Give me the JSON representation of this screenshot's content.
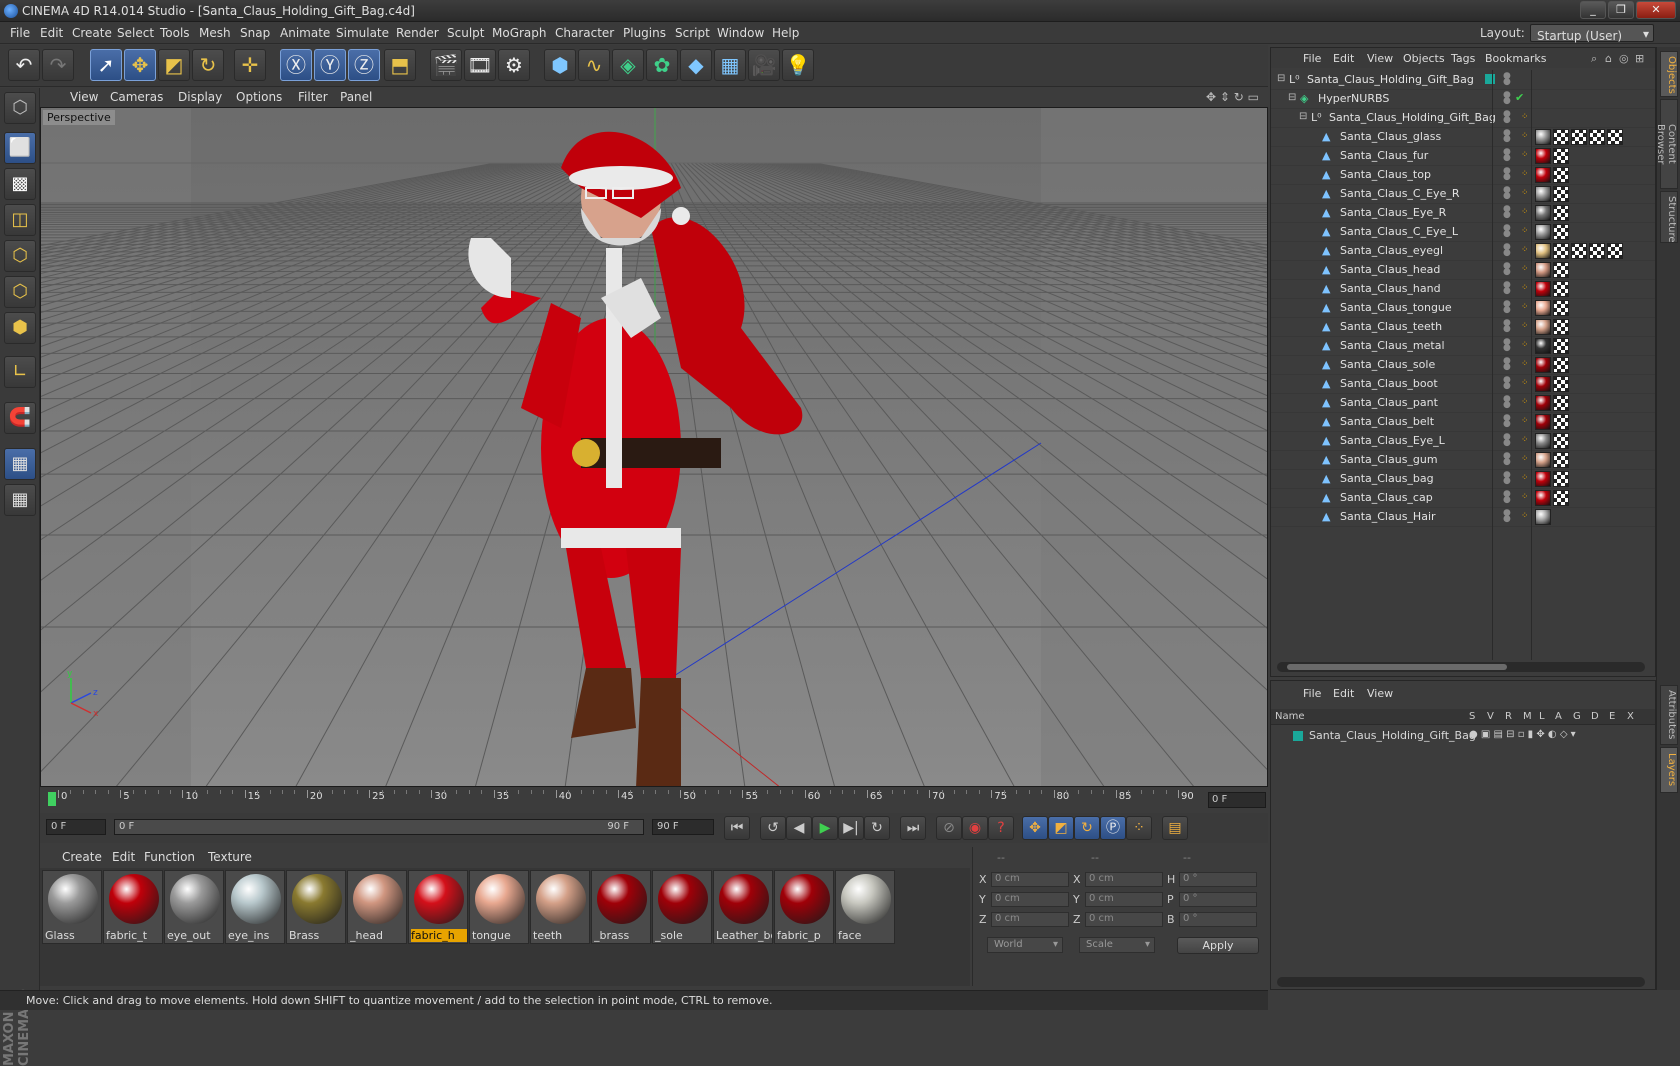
{
  "window": {
    "title": "CINEMA 4D R14.014 Studio - [Santa_Claus_Holding_Gift_Bag.c4d]",
    "controls": [
      "_",
      "❐",
      "✕"
    ]
  },
  "menu": [
    "File",
    "Edit",
    "Create",
    "Select",
    "Tools",
    "Mesh",
    "Snap",
    "Animate",
    "Simulate",
    "Render",
    "Sculpt",
    "MoGraph",
    "Character",
    "Plugins",
    "Script",
    "Window",
    "Help"
  ],
  "layout": {
    "label": "Layout:",
    "value": "Startup (User)"
  },
  "viewport": {
    "menu": [
      "View",
      "Cameras",
      "Display",
      "Options",
      "Filter",
      "Panel"
    ],
    "label": "Perspective"
  },
  "timeline": {
    "ticks": [
      "0",
      "5",
      "10",
      "15",
      "20",
      "25",
      "30",
      "35",
      "40",
      "45",
      "50",
      "55",
      "60",
      "65",
      "70",
      "75",
      "80",
      "85",
      "90"
    ],
    "current_frame": "0 F",
    "start_field": "0 F",
    "range_start": "0 F",
    "range_end": "90 F",
    "end_field": "90 F"
  },
  "materials": {
    "menu": [
      "Create",
      "Edit",
      "Function",
      "Texture"
    ],
    "items": [
      {
        "label": "Glass",
        "color": "#9a9a9a",
        "selected": false
      },
      {
        "label": "fabric_t",
        "color": "#c0000a",
        "selected": false
      },
      {
        "label": "eye_out",
        "color": "#9a9a9a",
        "selected": false
      },
      {
        "label": "eye_ins",
        "color": "#b8c8cc",
        "selected": false
      },
      {
        "label": "Brass",
        "color": "#8a7a30",
        "selected": false
      },
      {
        "label": "_head",
        "color": "#d09680",
        "selected": false
      },
      {
        "label": "fabric_h",
        "color": "#d4101a",
        "selected": true
      },
      {
        "label": "tongue",
        "color": "#e8a890",
        "selected": false
      },
      {
        "label": "teeth",
        "color": "#d4a088",
        "selected": false
      },
      {
        "label": "_brass",
        "color": "#a00008",
        "selected": false
      },
      {
        "label": "_sole",
        "color": "#a00008",
        "selected": false
      },
      {
        "label": "Leather_bo",
        "color": "#a00008",
        "selected": false
      },
      {
        "label": "fabric_p",
        "color": "#a00008",
        "selected": false
      },
      {
        "label": "face",
        "color": "#c8c8c0",
        "selected": false
      }
    ]
  },
  "coords": {
    "headers": [
      "--",
      "--",
      "--"
    ],
    "rows": [
      {
        "a": "X",
        "av": "0 cm",
        "b": "X",
        "bv": "0 cm",
        "c": "H",
        "cv": "0 °"
      },
      {
        "a": "Y",
        "av": "0 cm",
        "b": "Y",
        "bv": "0 cm",
        "c": "P",
        "cv": "0 °"
      },
      {
        "a": "Z",
        "av": "0 cm",
        "b": "Z",
        "bv": "0 cm",
        "c": "B",
        "cv": "0 °"
      }
    ],
    "mode": "World",
    "transform": "Scale",
    "apply": "Apply"
  },
  "status": "Move: Click and drag to move elements. Hold down SHIFT to quantize movement / add to the selection in point mode, CTRL to remove.",
  "objects": {
    "menu": [
      "File",
      "Edit",
      "View",
      "Objects",
      "Tags",
      "Bookmarks"
    ],
    "tree": [
      {
        "name": "Santa_Claus_Holding_Gift_Bag",
        "level": 0,
        "type": "null"
      },
      {
        "name": "HyperNURBS",
        "level": 1,
        "type": "nurbs"
      },
      {
        "name": "Santa_Claus_Holding_Gift_Bag",
        "level": 2,
        "type": "null"
      },
      {
        "name": "Santa_Claus_glass",
        "level": 3,
        "type": "mesh"
      },
      {
        "name": "Santa_Claus_fur",
        "level": 3,
        "type": "mesh"
      },
      {
        "name": "Santa_Claus_top",
        "level": 3,
        "type": "mesh"
      },
      {
        "name": "Santa_Claus_C_Eye_R",
        "level": 3,
        "type": "mesh"
      },
      {
        "name": "Santa_Claus_Eye_R",
        "level": 3,
        "type": "mesh"
      },
      {
        "name": "Santa_Claus_C_Eye_L",
        "level": 3,
        "type": "mesh"
      },
      {
        "name": "Santa_Claus_eyegl",
        "level": 3,
        "type": "mesh"
      },
      {
        "name": "Santa_Claus_head",
        "level": 3,
        "type": "mesh"
      },
      {
        "name": "Santa_Claus_hand",
        "level": 3,
        "type": "mesh"
      },
      {
        "name": "Santa_Claus_tongue",
        "level": 3,
        "type": "mesh"
      },
      {
        "name": "Santa_Claus_teeth",
        "level": 3,
        "type": "mesh"
      },
      {
        "name": "Santa_Claus_metal",
        "level": 3,
        "type": "mesh"
      },
      {
        "name": "Santa_Claus_sole",
        "level": 3,
        "type": "mesh"
      },
      {
        "name": "Santa_Claus_boot",
        "level": 3,
        "type": "mesh"
      },
      {
        "name": "Santa_Claus_pant",
        "level": 3,
        "type": "mesh"
      },
      {
        "name": "Santa_Claus_belt",
        "level": 3,
        "type": "mesh"
      },
      {
        "name": "Santa_Claus_Eye_L",
        "level": 3,
        "type": "mesh"
      },
      {
        "name": "Santa_Claus_gum",
        "level": 3,
        "type": "mesh"
      },
      {
        "name": "Santa_Claus_bag",
        "level": 3,
        "type": "mesh"
      },
      {
        "name": "Santa_Claus_cap",
        "level": 3,
        "type": "mesh"
      },
      {
        "name": "Santa_Claus_Hair",
        "level": 3,
        "type": "mesh"
      }
    ]
  },
  "layers": {
    "menu": [
      "File",
      "Edit",
      "View"
    ],
    "headers": [
      "Name",
      "S",
      "V",
      "R",
      "M",
      "L",
      "A",
      "G",
      "D",
      "E",
      "X"
    ],
    "rows": [
      {
        "name": "Santa_Claus_Holding_Gift_Bag",
        "color": "#1aa89a"
      }
    ]
  },
  "side_tabs": [
    "Objects",
    "Content Browser",
    "Structure",
    "Attributes",
    "Layers"
  ]
}
